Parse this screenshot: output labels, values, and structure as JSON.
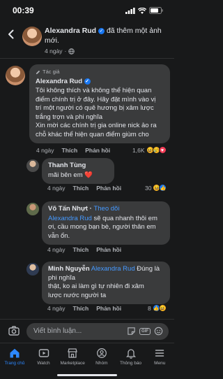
{
  "status_bar": {
    "time": "00:39"
  },
  "header": {
    "author": "Alexandra Rud",
    "action_text": "đã thêm một ảnh mới.",
    "time_ago": "4 ngày"
  },
  "comments": [
    {
      "tag": "Tác giả",
      "author": "Alexandra Rud",
      "lines": [
        "Tôi không thích và không thể hiện quan",
        "điểm chính trị ở đây. Hãy đặt mình vào vị",
        "trí một người có quê hương bị xâm lược",
        "trắng trợn và phi nghĩa",
        "Xin mời các chính trị gia online nick ảo ra",
        "chỗ khác thể hiện quan điểm giùm cho"
      ],
      "time_ago": "4 ngày",
      "like_label": "Thích",
      "reply_label": "Phản hồi",
      "reaction_count": "1,6K"
    },
    {
      "author": "Thanh Tùng",
      "text": "mãi bên em ❤️",
      "time_ago": "4 ngày",
      "like_label": "Thích",
      "reply_label": "Phản hồi",
      "reaction_count": "30"
    },
    {
      "author": "Võ Tấn Nhựt",
      "follow_label": "Theo dõi",
      "mention": "Alexandra Rud",
      "text": " sẽ qua nhanh thôi em",
      "lines": [
        "ơi, cầu mong bạn bè, người thân em",
        "vẫn ổn."
      ],
      "time_ago": "4 ngày",
      "like_label": "Thích",
      "reply_label": "Phản hồi"
    },
    {
      "author": "Minh Nguyễn",
      "mention": "Alexandra Rud",
      "lines": [
        "Đúng là phi nghĩa",
        "thật, ko ai làm gì tự nhiên đi xâm",
        "lược nước người ta"
      ],
      "time_ago": "4 ngày",
      "like_label": "Thích",
      "reply_label": "Phản hồi",
      "reaction_count": "8"
    }
  ],
  "composer": {
    "placeholder": "Viết bình luận..."
  },
  "tabbar": [
    {
      "label": "Trang chủ",
      "icon": "home-icon",
      "active": true
    },
    {
      "label": "Watch",
      "icon": "watch-icon"
    },
    {
      "label": "Marketplace",
      "icon": "marketplace-icon"
    },
    {
      "label": "Nhóm",
      "icon": "groups-icon"
    },
    {
      "label": "Thông báo",
      "icon": "bell-icon"
    },
    {
      "label": "Menu",
      "icon": "menu-icon"
    }
  ],
  "colors": {
    "background": "#18191a",
    "bubble": "#3a3b3c",
    "accent": "#2d88ff",
    "link": "#4599ff"
  }
}
